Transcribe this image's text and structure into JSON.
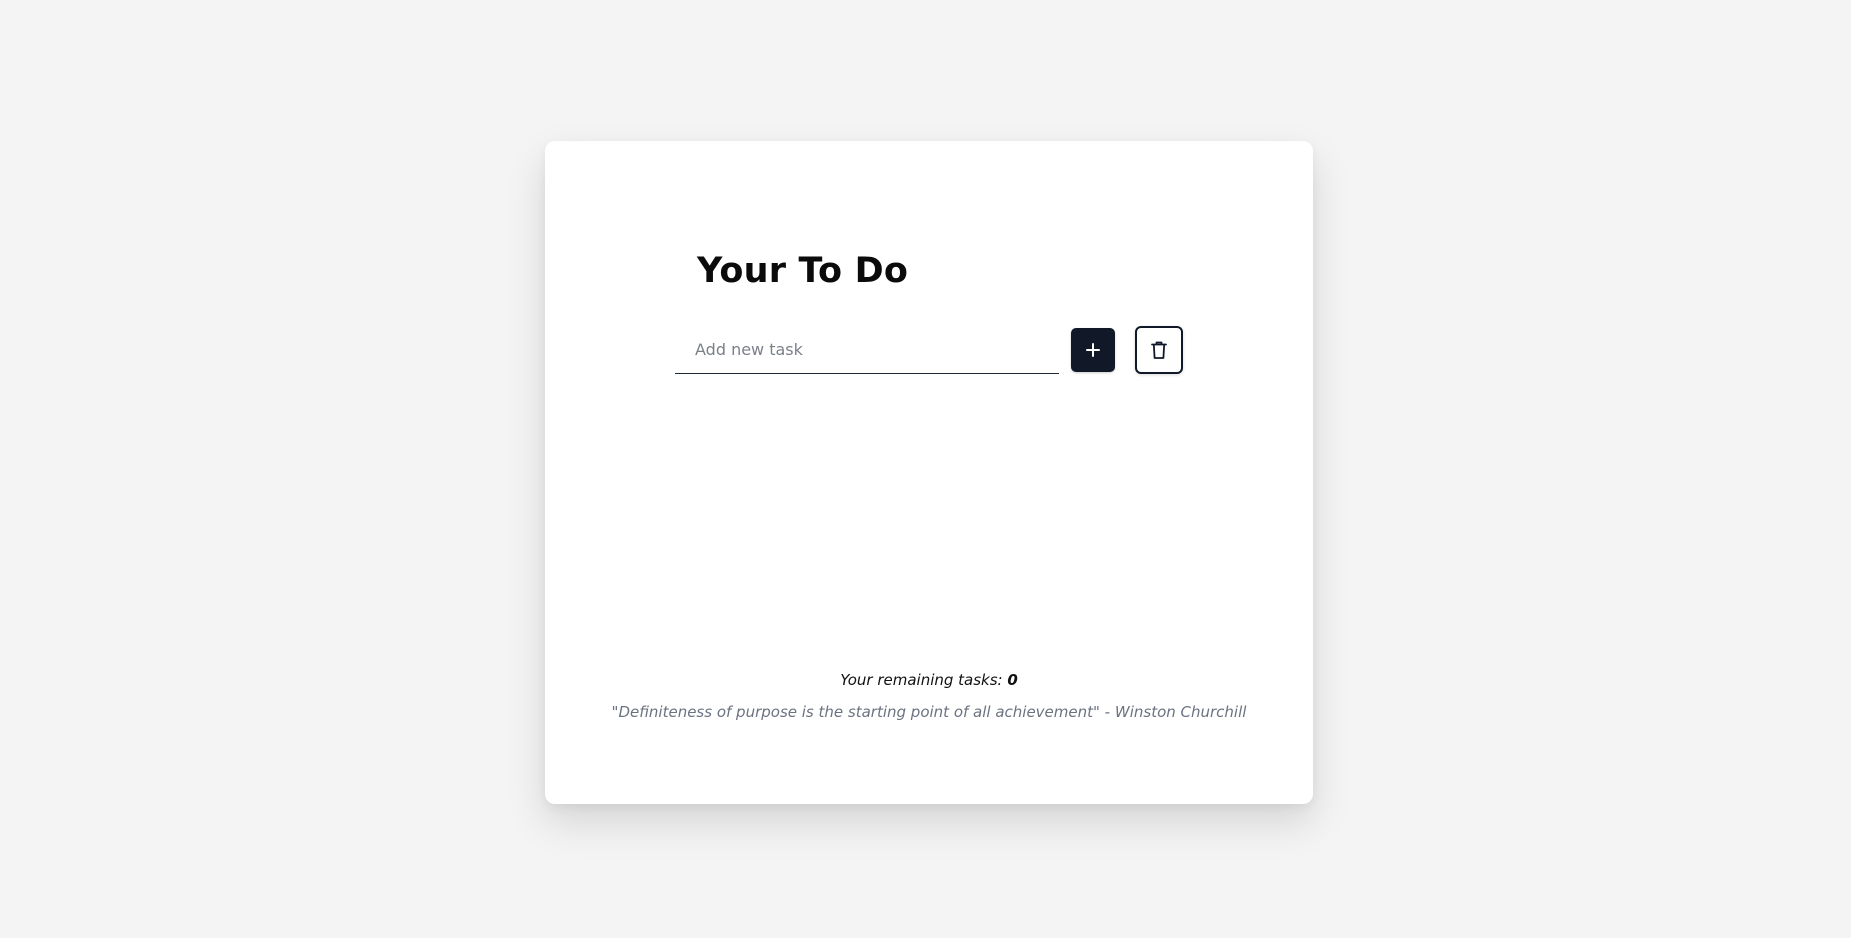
{
  "card": {
    "title": "Your To Do"
  },
  "task_form": {
    "input_value": "",
    "input_placeholder": "Add new task",
    "add_icon": "plus-icon",
    "clear_icon": "trash-icon"
  },
  "summary": {
    "remaining_label": "Your remaining tasks: ",
    "remaining_count": "0"
  },
  "quote": {
    "text": "\"Definiteness of purpose is the starting point of all achievement\" - Winston Churchill"
  },
  "colors": {
    "background": "#f4f4f4",
    "card": "#ffffff",
    "primary": "#111827",
    "muted": "#6b7280"
  }
}
